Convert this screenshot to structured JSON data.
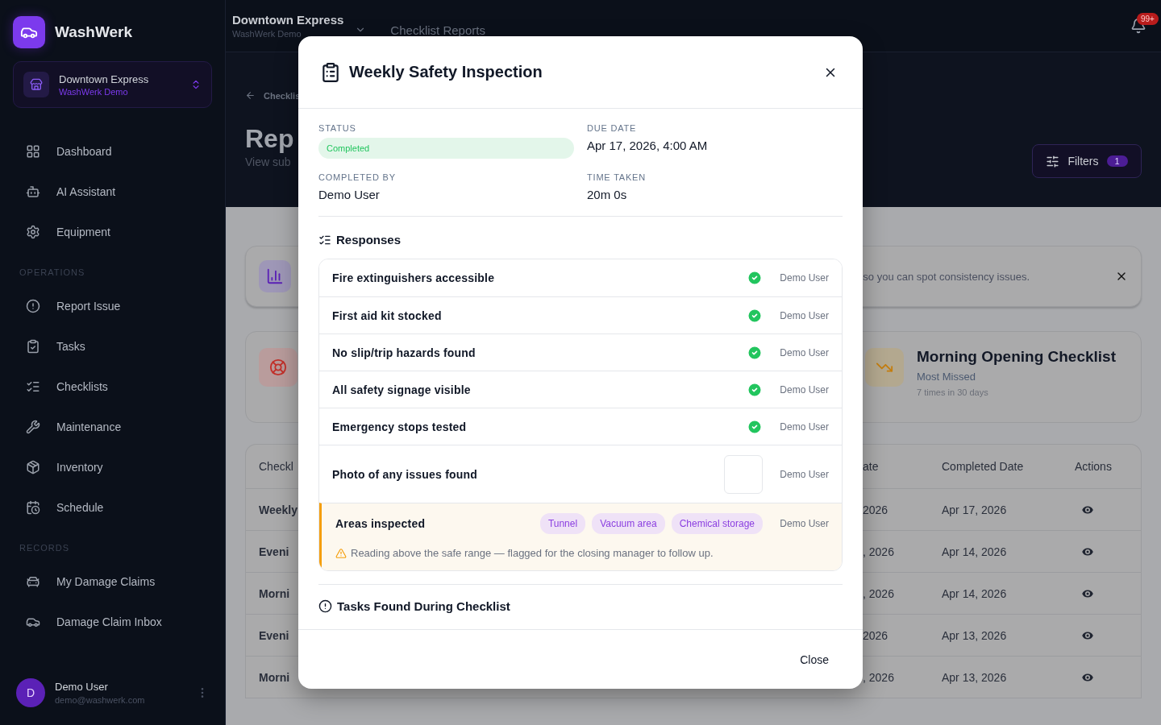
{
  "sidebar": {
    "brand": "WashWerk",
    "store": {
      "name": "Downtown Express",
      "org": "WashWerk Demo"
    },
    "sections": [
      {
        "items": [
          {
            "label": "Dashboard"
          },
          {
            "label": "AI Assistant"
          },
          {
            "label": "Equipment"
          }
        ]
      },
      {
        "label": "OPERATIONS",
        "items": [
          {
            "label": "Report Issue"
          },
          {
            "label": "Tasks"
          },
          {
            "label": "Checklists"
          },
          {
            "label": "Maintenance"
          },
          {
            "label": "Inventory"
          },
          {
            "label": "Schedule"
          }
        ]
      },
      {
        "label": "RECORDS",
        "items": [
          {
            "label": "My Damage Claims"
          },
          {
            "label": "Damage Claim Inbox"
          }
        ]
      }
    ],
    "user": {
      "initial": "D",
      "name": "Demo User",
      "email": "demo@washwerk.com"
    }
  },
  "header": {
    "store_name": "Downtown Express",
    "store_org": "WashWerk Demo",
    "page": "Checklist Reports",
    "notifications": "99+"
  },
  "hero": {
    "breadcrumb": "Checklis",
    "title": "Rep",
    "subtitle": "View sub",
    "filters": {
      "label": "Filters",
      "count": "1"
    }
  },
  "banner": {
    "text": "so you can spot consistency issues."
  },
  "stat": {
    "title": "Morning Opening Checklist",
    "label": "Most Missed",
    "detail": "7 times in 30 days"
  },
  "table": {
    "columns": [
      "Checkl",
      "ate",
      "Completed Date",
      "Actions"
    ],
    "rows": [
      {
        "name": "Weekly",
        "due": "2026",
        "completed": "Apr 17, 2026"
      },
      {
        "name": "Eveni",
        "due": ", 2026",
        "completed": "Apr 14, 2026"
      },
      {
        "name": "Morni",
        "due": ", 2026",
        "completed": "Apr 14, 2026"
      },
      {
        "name": "Eveni",
        "due": "2026",
        "completed": "Apr 13, 2026"
      },
      {
        "name": "Morni",
        "due": ", 2026",
        "completed": "Apr 13, 2026"
      }
    ]
  },
  "modal": {
    "title": "Weekly Safety Inspection",
    "fields": [
      {
        "label": "STATUS",
        "value": "Completed",
        "kind": "badge"
      },
      {
        "label": "DUE DATE",
        "value": "Apr 17, 2026, 4:00 AM",
        "kind": "text"
      },
      {
        "label": "COMPLETED BY",
        "value": "Demo User",
        "kind": "text"
      },
      {
        "label": "TIME TAKEN",
        "value": "20m 0s",
        "kind": "text"
      }
    ],
    "responses_heading": "Responses",
    "responses": [
      {
        "question": "Fire extinguishers accessible",
        "kind": "check",
        "user": "Demo User",
        "flagged": false
      },
      {
        "question": "First aid kit stocked",
        "kind": "check",
        "user": "Demo User",
        "flagged": false
      },
      {
        "question": "No slip/trip hazards found",
        "kind": "check",
        "user": "Demo User",
        "flagged": false
      },
      {
        "question": "All safety signage visible",
        "kind": "check",
        "user": "Demo User",
        "flagged": false
      },
      {
        "question": "Emergency stops tested",
        "kind": "check",
        "user": "Demo User",
        "flagged": false
      },
      {
        "question": "Photo of any issues found",
        "kind": "photo",
        "user": "Demo User",
        "flagged": false
      },
      {
        "question": "Areas inspected",
        "kind": "tags",
        "tags": [
          "Tunnel",
          "Vacuum area",
          "Chemical storage"
        ],
        "user": "Demo User",
        "flagged": true,
        "warning": "Reading above the safe range — flagged for the closing manager to follow up."
      }
    ],
    "tasks_heading": "Tasks Found During Checklist",
    "close": "Close"
  }
}
